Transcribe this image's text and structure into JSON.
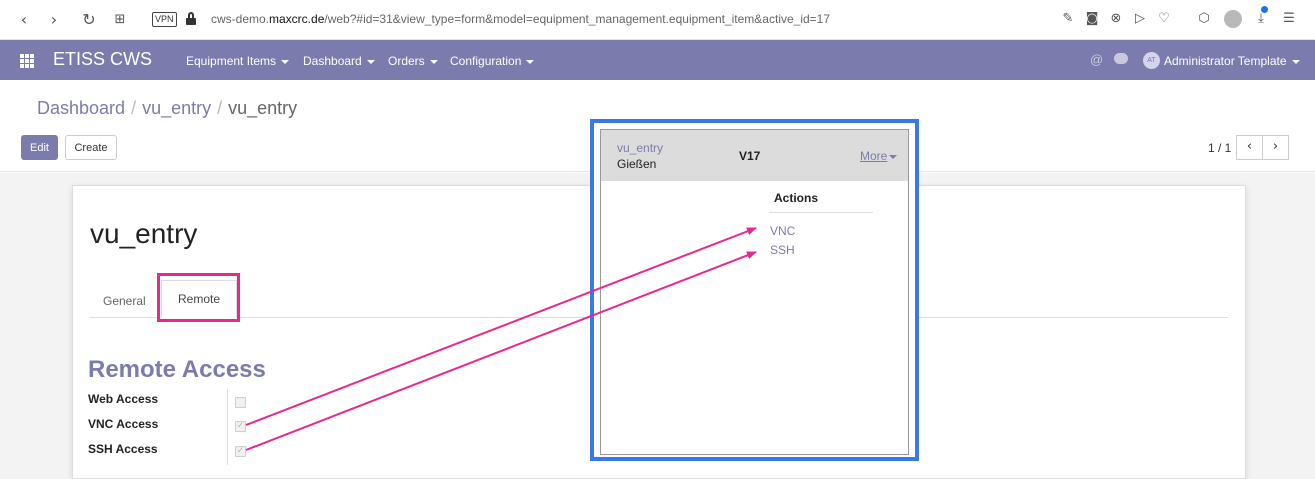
{
  "browser": {
    "vpn_label": "VPN",
    "url_prefix": "cws-demo.",
    "url_domain": "maxcrc.de",
    "url_rest": "/web?#id=31&view_type=form&model=equipment_management.equipment_item&active_id=17"
  },
  "topnav": {
    "brand": "ETISS CWS",
    "menus": [
      "Equipment Items",
      "Dashboard",
      "Orders",
      "Configuration"
    ],
    "at_symbol": "@",
    "avatar_initials": "AT",
    "user": "Administrator Template"
  },
  "breadcrumb": [
    "Dashboard",
    "vu_entry",
    "vu_entry"
  ],
  "buttons": {
    "edit": "Edit",
    "create": "Create"
  },
  "pager": {
    "text": "1 / 1",
    "prev": "‹",
    "next": "›"
  },
  "record": {
    "title": "vu_entry",
    "tabs": [
      "General",
      "Remote"
    ],
    "section_title": "Remote Access",
    "fields": [
      {
        "label": "Web Access",
        "checked": false
      },
      {
        "label": "VNC Access",
        "checked": true
      },
      {
        "label": "SSH Access",
        "checked": true
      }
    ]
  },
  "popup": {
    "subtitle": "vu_entry",
    "city": "Gießen",
    "title": "V17",
    "more": "More",
    "actions_title": "Actions",
    "actions": [
      "VNC",
      "SSH"
    ]
  },
  "colors": {
    "nav": "#7c7bad",
    "highlight": "#e8288c",
    "callout_border": "#3a78e8"
  }
}
